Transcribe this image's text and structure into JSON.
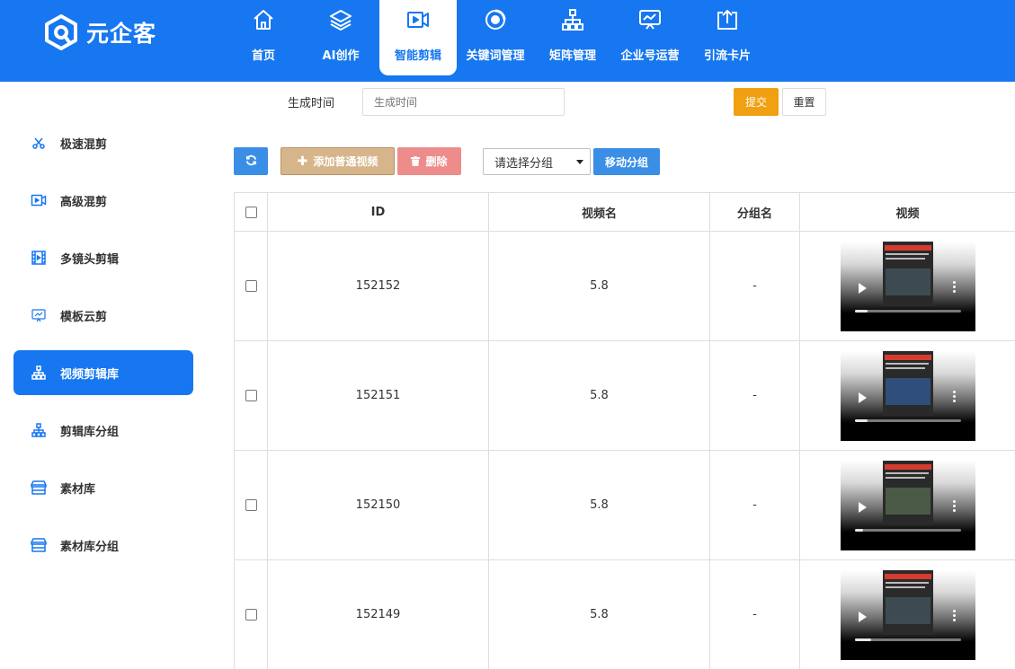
{
  "brand": {
    "name": "元企客"
  },
  "nav": [
    {
      "label": "首页",
      "icon": "home-icon",
      "active": false
    },
    {
      "label": "AI创作",
      "icon": "layers-icon",
      "active": false
    },
    {
      "label": "智能剪辑",
      "icon": "video-camera-icon",
      "active": true
    },
    {
      "label": "关键词管理",
      "icon": "target-icon",
      "active": false
    },
    {
      "label": "矩阵管理",
      "icon": "hierarchy-icon",
      "active": false
    },
    {
      "label": "企业号运营",
      "icon": "presentation-icon",
      "active": false
    },
    {
      "label": "引流卡片",
      "icon": "upload-box-icon",
      "active": false
    }
  ],
  "sidebar": [
    {
      "label": "极速混剪",
      "icon": "scissors-icon",
      "active": false
    },
    {
      "label": "高级混剪",
      "icon": "video-camera-icon",
      "active": false
    },
    {
      "label": "多镜头剪辑",
      "icon": "film-icon",
      "active": false
    },
    {
      "label": "模板云剪",
      "icon": "presentation-icon",
      "active": false
    },
    {
      "label": "视频剪辑库",
      "icon": "hierarchy-icon",
      "active": true
    },
    {
      "label": "剪辑库分组",
      "icon": "hierarchy-icon",
      "active": false
    },
    {
      "label": "素材库",
      "icon": "store-icon",
      "active": false
    },
    {
      "label": "素材库分组",
      "icon": "store-icon",
      "active": false
    }
  ],
  "filter": {
    "label": "生成时间",
    "placeholder": "生成时间",
    "submit": "提交",
    "reset": "重置"
  },
  "toolbar": {
    "add": "添加普通视频",
    "delete": "删除",
    "group_select": "请选择分组",
    "move": "移动分组"
  },
  "table": {
    "headers": {
      "id": "ID",
      "name": "视频名",
      "group": "分组名",
      "video": "视频"
    },
    "rows": [
      {
        "id": "152152",
        "name": "5.8",
        "group": "-",
        "progress": 0.12
      },
      {
        "id": "152151",
        "name": "5.8",
        "group": "-",
        "progress": 0.12
      },
      {
        "id": "152150",
        "name": "5.8",
        "group": "-",
        "progress": 0.08
      },
      {
        "id": "152149",
        "name": "5.8",
        "group": "-",
        "progress": 0.16
      }
    ]
  },
  "colors": {
    "primary": "#1677f0",
    "submit": "#f0a010",
    "add": "#d7b58a",
    "delete": "#ee8b8b"
  }
}
